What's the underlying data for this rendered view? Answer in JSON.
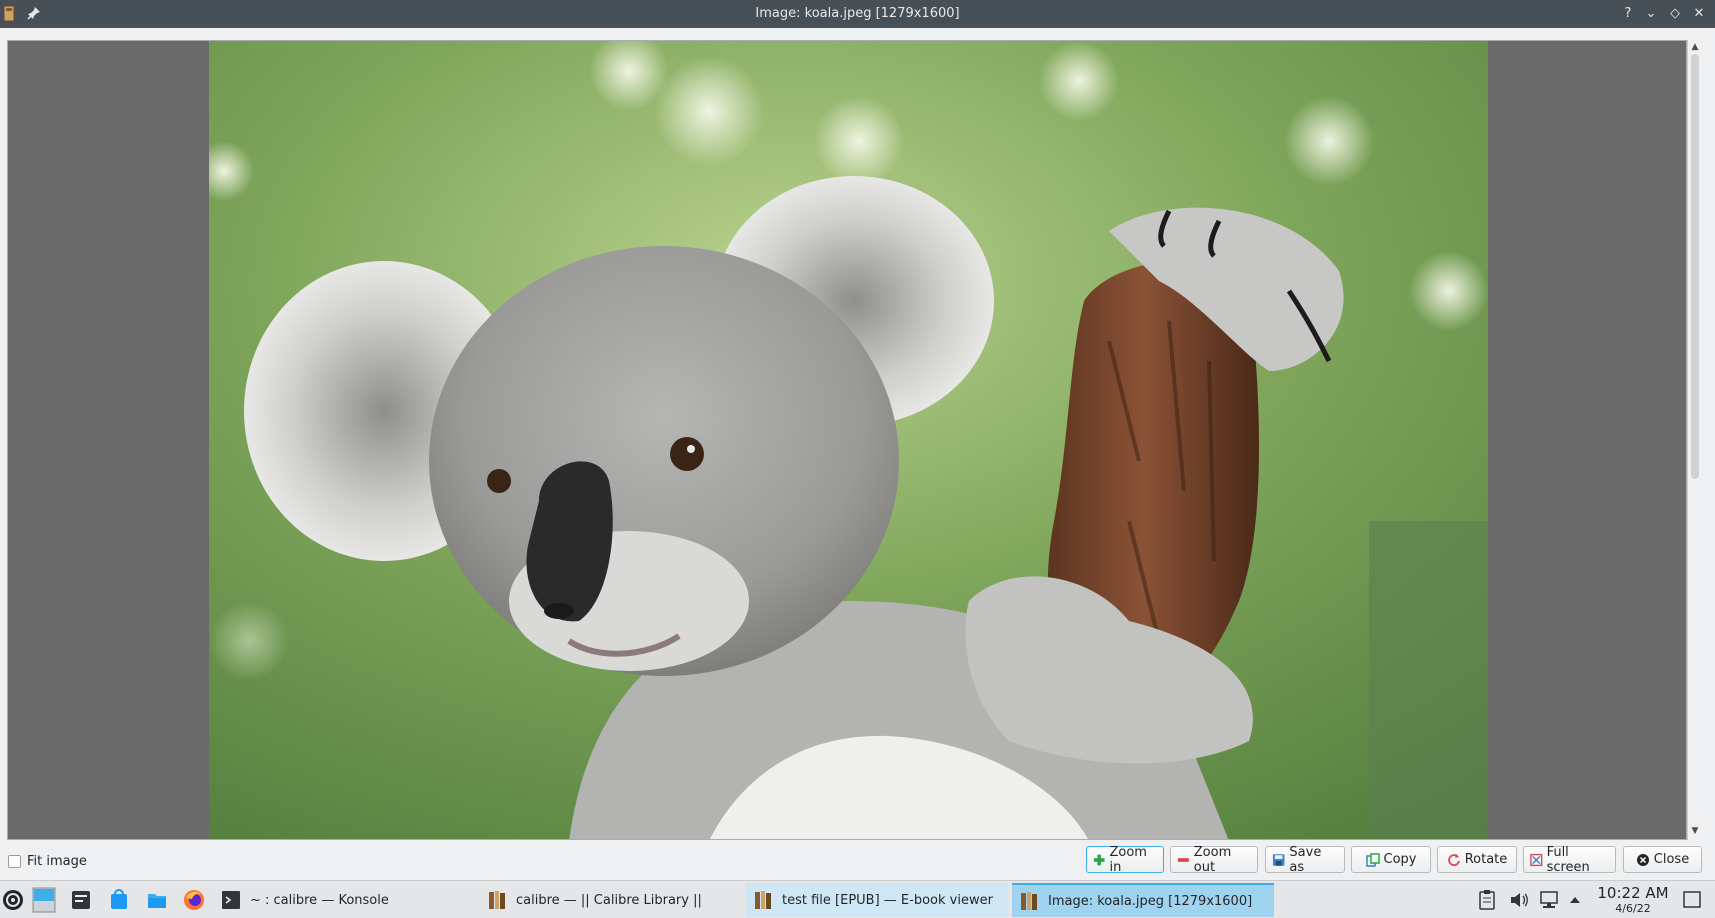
{
  "window": {
    "title": "Image: koala.jpeg [1279x1600]",
    "icons": [
      "calibre-app-icon",
      "pin-icon",
      "help-icon",
      "minimize-icon",
      "maximize-icon",
      "close-icon"
    ],
    "help_glyph": "?",
    "minimize_glyph": "⌄",
    "maximize_glyph": "◇",
    "close_glyph": "✕"
  },
  "viewer": {
    "background": "#6a6a6a"
  },
  "controls": {
    "fit_image_label": "Fit image",
    "fit_image_checked": false,
    "buttons": {
      "zoom_in": "Zoom in",
      "zoom_out": "Zoom out",
      "save_as": "Save as",
      "copy": "Copy",
      "rotate": "Rotate",
      "full_screen": "Full screen",
      "close": "Close"
    }
  },
  "taskbar": {
    "tasks": {
      "konsole": "~ : calibre — Konsole",
      "calibre": "calibre — || Calibre Library ||",
      "ebook_viewer": "test file [EPUB] — E-book viewer",
      "image": "Image: koala.jpeg [1279x1600]"
    },
    "clock": {
      "time": "10:22 AM",
      "date": "4/6/22"
    },
    "accent": "#3daee9"
  }
}
